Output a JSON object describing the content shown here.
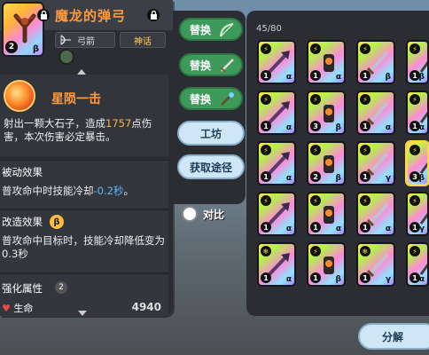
{
  "item": {
    "name": "魔龙的弹弓",
    "count": "2",
    "grade": "β",
    "type_tag": "弓箭",
    "rarity_tag": "神话"
  },
  "skill": {
    "title": "星陨一击",
    "desc_part1": "射出一颗大石子，造成",
    "desc_value": "1757",
    "desc_part2": "点伤害，本次伤害必定暴击。"
  },
  "passive": {
    "title": "被动效果",
    "text_prefix": "普攻命中时技能冷却",
    "text_value": "-0.2秒",
    "text_suffix": "。"
  },
  "modify": {
    "title": "改造效果",
    "badge": "β",
    "text": "普攻命中目标时，技能冷却降低变为0.3秒"
  },
  "enhance": {
    "title": "强化属性",
    "level": "2",
    "life_label": "生命",
    "life_value": "4940"
  },
  "buttons": {
    "replace": "替换",
    "workshop": "工坊",
    "obtain": "获取途径",
    "compare": "对比",
    "decompose": "分解"
  },
  "inventory": {
    "count": "45/80",
    "slots": [
      {
        "num": "1",
        "grade": "α",
        "icon": "⚡"
      },
      {
        "num": "1",
        "grade": "α",
        "icon": "⚡"
      },
      {
        "num": "1",
        "grade": "β",
        "icon": "⚡"
      },
      {
        "num": "1",
        "grade": "β",
        "icon": "⚡"
      },
      {
        "num": "1",
        "grade": "α",
        "icon": "⚡"
      },
      {
        "num": "3",
        "grade": "β",
        "icon": "⚡"
      },
      {
        "num": "1",
        "grade": "α",
        "icon": "⚡"
      },
      {
        "num": "1",
        "grade": "α",
        "icon": "⚡"
      },
      {
        "num": "1",
        "grade": "α",
        "icon": "⚡"
      },
      {
        "num": "2",
        "grade": "β",
        "icon": "⚡"
      },
      {
        "num": "1",
        "grade": "γ",
        "icon": "⚡"
      },
      {
        "num": "3",
        "grade": "β",
        "icon": "⚡"
      },
      {
        "num": "1",
        "grade": "α",
        "icon": "⚡"
      },
      {
        "num": "1",
        "grade": "α",
        "icon": "⚡"
      },
      {
        "num": "1",
        "grade": "α",
        "icon": "⚡"
      },
      {
        "num": "1",
        "grade": "γ",
        "icon": "⚡"
      },
      {
        "num": "1",
        "grade": "α",
        "icon": "❄"
      },
      {
        "num": "1",
        "grade": "β",
        "icon": "⚡"
      },
      {
        "num": "1",
        "grade": "γ",
        "icon": "❄"
      },
      {
        "num": "1",
        "grade": "α",
        "icon": "⚡"
      }
    ]
  }
}
